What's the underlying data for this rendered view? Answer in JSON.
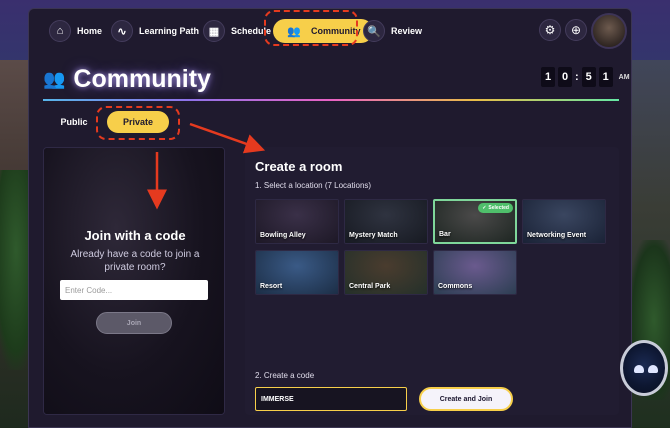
{
  "nav": {
    "items": [
      {
        "label": "Home",
        "icon": "home-icon",
        "glyph": "⌂"
      },
      {
        "label": "Learning Path",
        "icon": "path-icon",
        "glyph": "∿"
      },
      {
        "label": "Schedule",
        "icon": "calendar-icon",
        "glyph": "▦"
      },
      {
        "label": "Community",
        "icon": "people-icon",
        "glyph": "👥"
      },
      {
        "label": "Review",
        "icon": "search-icon",
        "glyph": "🔍"
      }
    ],
    "active": "Community",
    "settings_glyph": "⚙",
    "help_glyph": "⊕"
  },
  "page": {
    "title": "Community"
  },
  "clock": {
    "h1": "1",
    "h2": "0",
    "m1": "5",
    "m2": "1",
    "ampm": "AM"
  },
  "tabs": {
    "public": "Public",
    "private": "Private"
  },
  "join": {
    "title": "Join with a code",
    "description": "Already have a code to join a private room?",
    "input_placeholder": "Enter Code...",
    "button": "Join"
  },
  "create": {
    "title": "Create a room",
    "step1": "1. Select a location (7 Locations)",
    "locations": [
      {
        "name": "Bowling Alley",
        "selected": false,
        "colors": [
          "#3a3048",
          "#1d1826"
        ]
      },
      {
        "name": "Mystery Match",
        "selected": false,
        "colors": [
          "#2f3340",
          "#171a22"
        ]
      },
      {
        "name": "Bar",
        "selected": true,
        "colors": [
          "#4b4a4a",
          "#1e2622"
        ]
      },
      {
        "name": "Networking Event",
        "selected": false,
        "colors": [
          "#3a4660",
          "#1a2236"
        ]
      },
      {
        "name": "Resort",
        "selected": false,
        "colors": [
          "#3a5a86",
          "#1c2e46"
        ]
      },
      {
        "name": "Central Park",
        "selected": false,
        "colors": [
          "#4a3c2e",
          "#24302a"
        ]
      },
      {
        "name": "Commons",
        "selected": false,
        "colors": [
          "#6a5a8e",
          "#2c3e52"
        ]
      }
    ],
    "selected_badge": "Selected",
    "step2": "2. Create a code",
    "code_value": "IMMERSE",
    "button": "Create and Join"
  },
  "annotation_color": "#e53a1f",
  "accent_color": "#f7cf4a"
}
